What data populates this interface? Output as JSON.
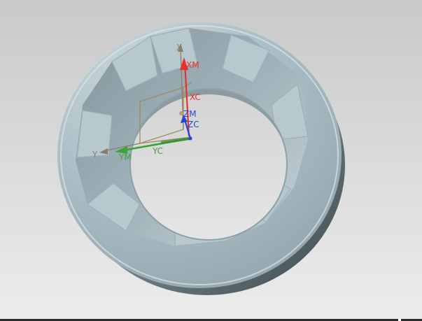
{
  "viewport": {
    "background_top": "#c9c9c9",
    "background_bottom": "#ececec"
  },
  "model": {
    "face_color": "#a9bcc3",
    "shadow_color": "#5f6d72",
    "highlight_color": "#dfe9ec"
  },
  "triad": {
    "x_label": "X",
    "y_label": "Y",
    "xm_label": "XM",
    "ym_label": "YM",
    "zm_label": "ZM",
    "xc_label": "XC",
    "yc_label": "YC",
    "zc_label": "ZC",
    "colors": {
      "x": "#e8312b",
      "y": "#3aa33a",
      "z": "#2447d6",
      "frame": "#9c8c63",
      "neutral": "#8a7e6a"
    }
  }
}
